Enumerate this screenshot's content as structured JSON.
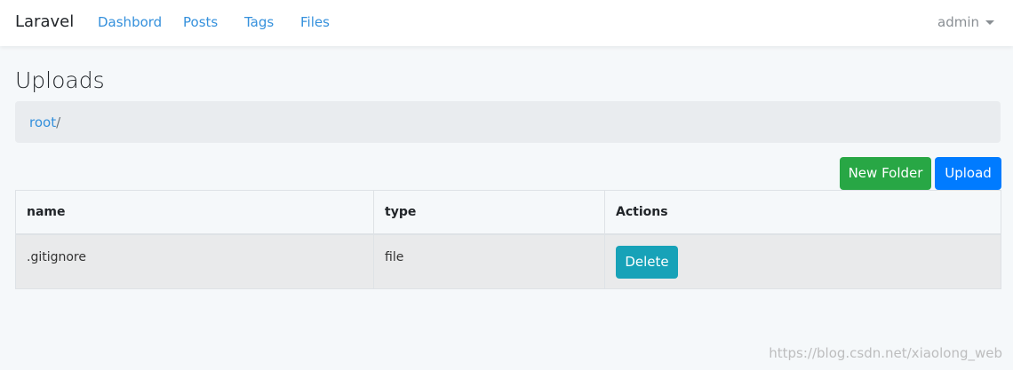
{
  "navbar": {
    "brand": "Laravel",
    "links": [
      "Dashbord",
      "Posts",
      "Tags",
      "Files"
    ],
    "user": "admin"
  },
  "page": {
    "title": "Uploads"
  },
  "breadcrumb": {
    "root_label": "root",
    "separator": "/"
  },
  "toolbar": {
    "new_folder_label": "New Folder",
    "upload_label": "Upload"
  },
  "table": {
    "headers": [
      "name",
      "type",
      "Actions"
    ],
    "rows": [
      {
        "name": ".gitignore",
        "type": "file",
        "action_label": "Delete"
      }
    ]
  },
  "watermark": "https://blog.csdn.net/xiaolong_web",
  "colors": {
    "link": "#3490dc",
    "success": "#28a745",
    "primary": "#007bff",
    "info": "#17a2b8"
  }
}
